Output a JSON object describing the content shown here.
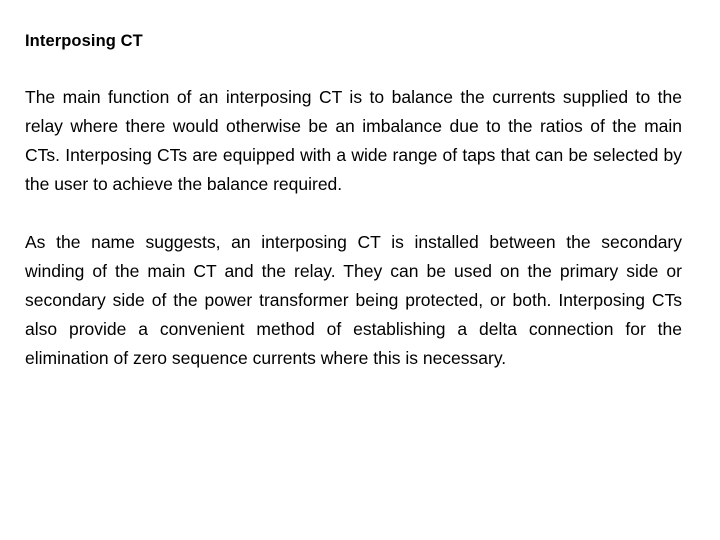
{
  "slide": {
    "title": "Interposing CT",
    "background_color": "#ffffff",
    "text_color": "#000000",
    "paragraphs": [
      {
        "id": "paragraph-1",
        "text": "The main function of an interposing CT is to balance the currents supplied to the relay where there would otherwise be an imbalance due to the ratios of the main CTs. Interposing CTs are equipped with a wide range of taps that can be selected by the user to achieve the balance required."
      },
      {
        "id": "paragraph-2",
        "text": "As the name suggests, an interposing CT is installed between the secondary winding of the main CT and the relay. They can be used on the primary side or secondary side of the power transformer being protected, or both. Interposing CTs also provide a convenient method of establishing a delta connection for the elimination of zero sequence currents where this is necessary."
      }
    ]
  }
}
